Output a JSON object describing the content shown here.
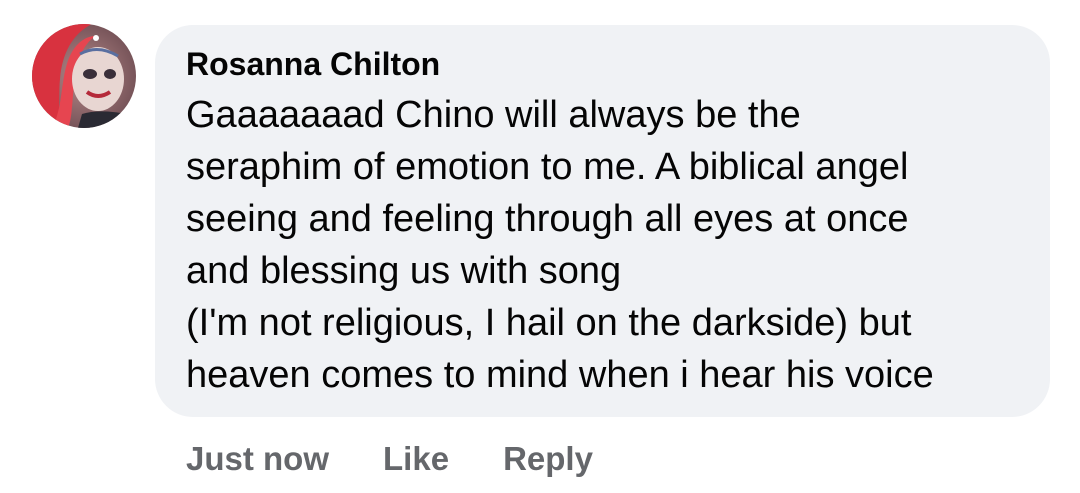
{
  "comment": {
    "author": "Rosanna Chilton",
    "avatar_icon": "user-avatar-photo",
    "text_lines": [
      "Gaaaaaaad Chino will always be the",
      "seraphim of emotion to me. A biblical angel",
      "seeing and feeling through all eyes at once",
      "and blessing us with song",
      "(I'm not religious, I hail on the darkside) but",
      "heaven comes to mind when i hear his voice"
    ],
    "bubble_color": "#f0f2f5",
    "text_color": "#050505"
  },
  "actions": {
    "timestamp": "Just now",
    "like_label": "Like",
    "reply_label": "Reply",
    "color": "#65676b"
  }
}
